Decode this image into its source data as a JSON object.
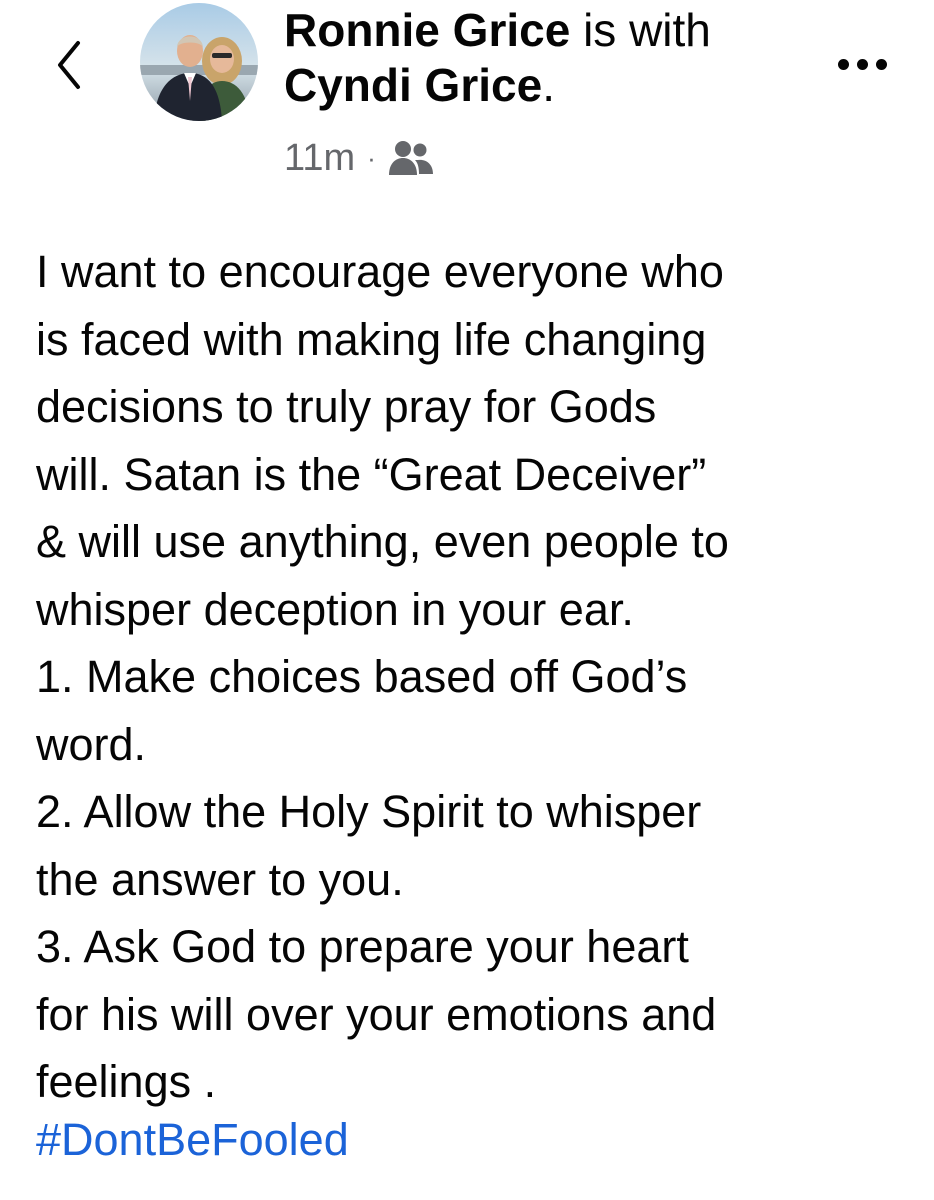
{
  "post": {
    "author": "Ronnie Grice",
    "with_text": "is with",
    "tagged": "Cyndi Grice",
    "tagged_suffix": ".",
    "time": "11m",
    "separator": "·",
    "privacy_icon": "friends-icon",
    "body_lines": [
      "I want to encourage everyone who",
      "is faced with making life changing",
      "decisions to truly pray for Gods",
      "will. Satan is the “Great Deceiver”",
      "& will use anything, even people to",
      "whisper deception in your ear.",
      "1. Make choices based off God’s",
      "word.",
      "2. Allow the Holy Spirit to whisper",
      "the answer to you.",
      "3. Ask God to prepare your heart",
      "for his will over your emotions and",
      "feelings ."
    ],
    "hashtag": "#DontBeFooled"
  },
  "nav": {
    "back_icon": "chevron-left-icon",
    "more_icon": "more-icon"
  },
  "colors": {
    "text": "#050505",
    "meta": "#65676b",
    "link": "#1b63d8"
  }
}
